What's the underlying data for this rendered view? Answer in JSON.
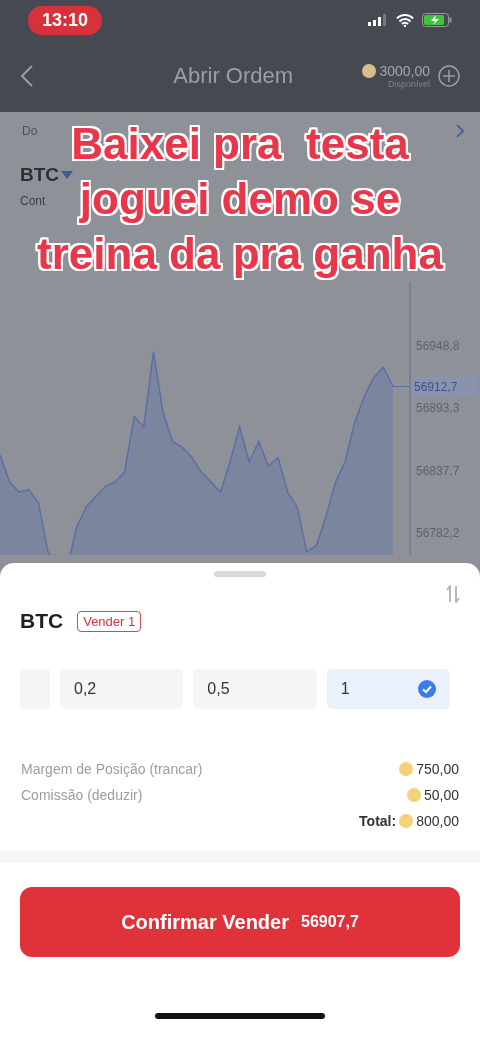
{
  "status_bar": {
    "time": "13:10"
  },
  "header": {
    "title": "Abrir Ordem",
    "balance": "3000,00",
    "balance_label": "Disponível"
  },
  "caption_lines": [
    "Baixei pra  testa",
    "joguei demo se",
    "treina da pra ganha"
  ],
  "background": {
    "row_label": "Do",
    "symbol": "BTC",
    "subtitle": "Cont"
  },
  "chart": {
    "current_price": "56912,7",
    "chart_data": {
      "type": "area",
      "series": [
        {
          "color": "#5a6fa8",
          "values": [
            56851,
            56827,
            56818,
            56820,
            56809,
            56765,
            null,
            null,
            56787,
            56805,
            56814,
            56823,
            56827,
            56836,
            56885,
            56876,
            56943,
            56889,
            56863,
            56858,
            56849,
            56836,
            56827,
            56818,
            56845,
            56876,
            56845,
            56863,
            56841,
            56849,
            56818,
            56805,
            56765,
            56770,
            56796,
            56827,
            56845,
            56880,
            56903,
            56920,
            56929,
            56912
          ]
        }
      ],
      "ylim": [
        56762,
        57005
      ],
      "yticks": [
        {
          "value": 56948.8,
          "label": "56948,8"
        },
        {
          "value": 56893.3,
          "label": "56893,3"
        },
        {
          "value": 56837.7,
          "label": "56837,7"
        },
        {
          "value": 56782.2,
          "label": "56782,2"
        }
      ]
    }
  },
  "sheet": {
    "symbol": "BTC",
    "tag": "Vender 1",
    "options": [
      {
        "label": "0,2",
        "selected": false
      },
      {
        "label": "0,5",
        "selected": false
      },
      {
        "label": "1",
        "selected": true
      }
    ],
    "fees": [
      {
        "label": "Margem de Posição (trancar)",
        "value": "750,00"
      },
      {
        "label": "Comissão (deduzir)",
        "value": "50,00"
      }
    ],
    "total_label": "Total:",
    "total_value": "800,00",
    "confirm_button": {
      "label": "Confirmar Vender",
      "price": "56907,7"
    }
  }
}
